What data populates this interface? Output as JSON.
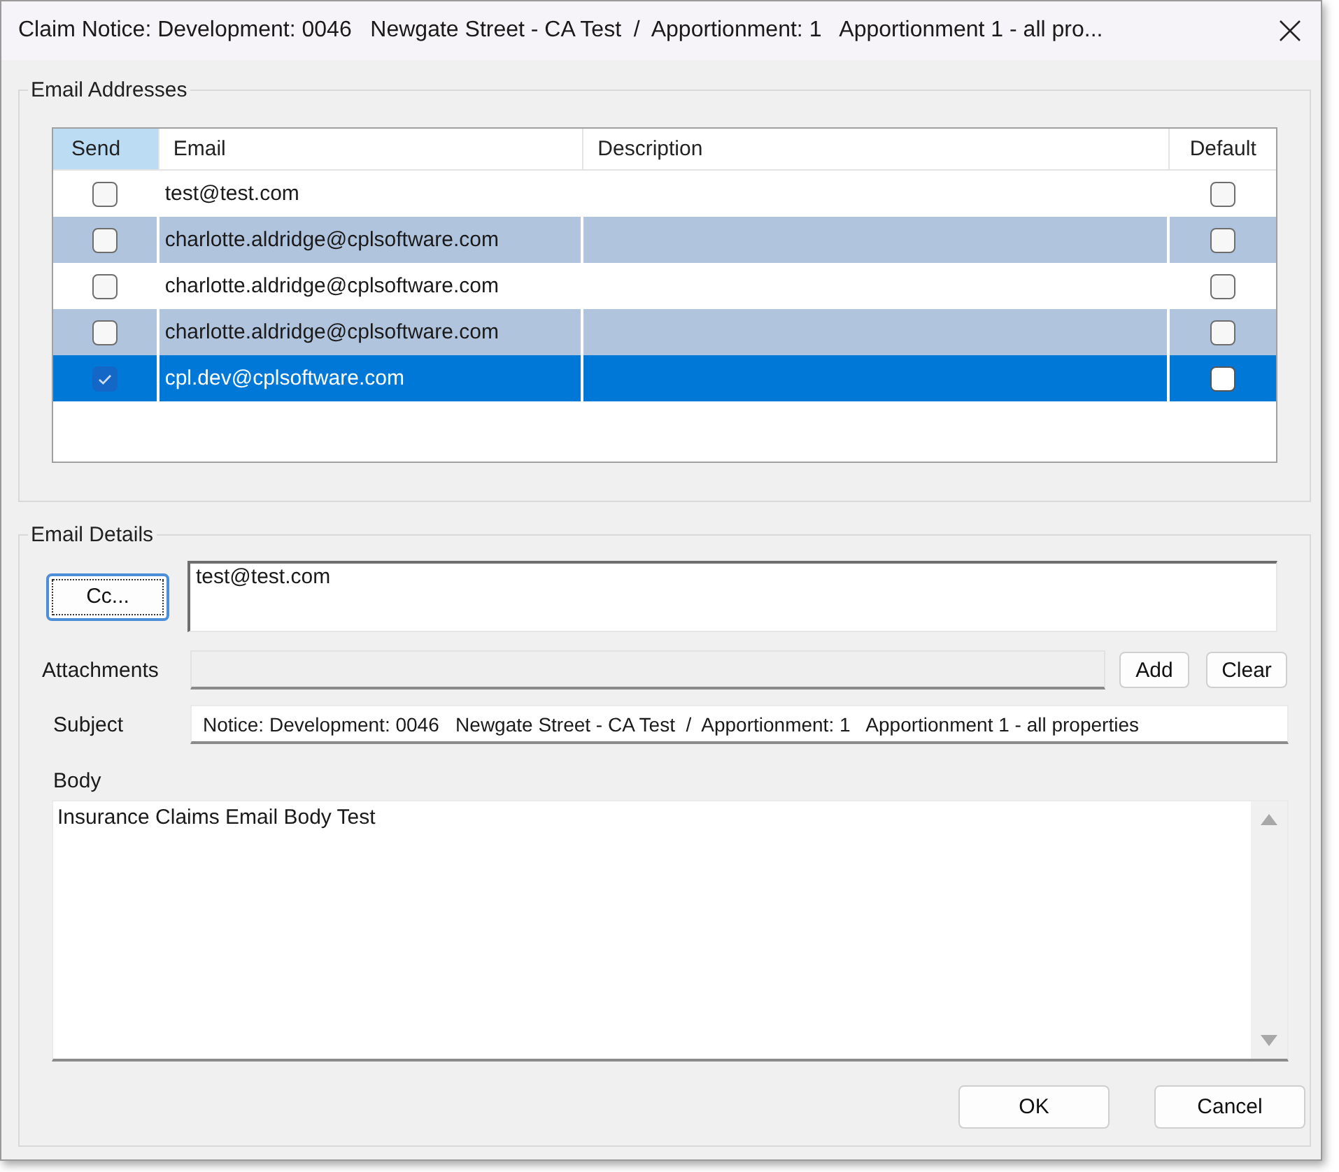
{
  "window": {
    "title": "Claim Notice: Development: 0046   Newgate Street - CA Test  /  Apportionment: 1   Apportionment 1 - all pro..."
  },
  "email_addresses": {
    "title": "Email Addresses",
    "columns": [
      {
        "label": "Send",
        "selected": true
      },
      {
        "label": "Email",
        "selected": false
      },
      {
        "label": "Description",
        "selected": false
      },
      {
        "label": "Default",
        "selected": false
      }
    ],
    "rows": [
      {
        "send": false,
        "email": "test@test.com",
        "default": false,
        "selected": false
      },
      {
        "send": false,
        "email": "charlotte.aldridge@cplsoftware.com",
        "default": false,
        "selected": false
      },
      {
        "send": false,
        "email": "charlotte.aldridge@cplsoftware.com",
        "default": false,
        "selected": false
      },
      {
        "send": false,
        "email": "charlotte.aldridge@cplsoftware.com",
        "default": false,
        "selected": false
      },
      {
        "send": true,
        "email": "cpl.dev@cplsoftware.com",
        "default": false,
        "selected": true
      }
    ]
  },
  "email_details": {
    "title": "Email Details",
    "cc_button": "Cc...",
    "cc": "test@test.com",
    "attachments_label": "Attachments",
    "add_button": "Add",
    "clear_button": "Clear",
    "subject_label": "Subject",
    "subject": "Notice: Development: 0046   Newgate Street - CA Test  /  Apportionment: 1   Apportionment 1 - all properties",
    "body_label": "Body",
    "body": "Insurance Claims Email Body Test"
  },
  "buttons": [
    "OK",
    "Cancel"
  ]
}
